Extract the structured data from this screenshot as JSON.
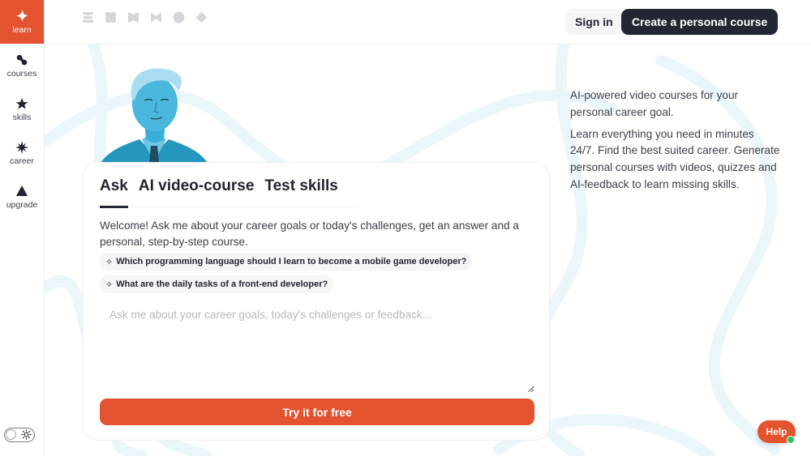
{
  "sidebar": {
    "items": [
      {
        "label": "learn",
        "icon": "sparkle-icon",
        "active": true
      },
      {
        "label": "courses",
        "icon": "link-icon"
      },
      {
        "label": "skills",
        "icon": "star-icon"
      },
      {
        "label": "career",
        "icon": "burst-icon"
      },
      {
        "label": "upgrade",
        "icon": "triangle-up-icon"
      }
    ],
    "theme_toggle": {
      "icon": "sun-icon",
      "state": "light"
    }
  },
  "header": {
    "partner_logos": [
      "stack-logo",
      "squircle-logo",
      "bowtie-logo-1",
      "bowtie-logo-2",
      "circle-logo",
      "gear-logo"
    ],
    "signin_label": "Sign in",
    "create_label": "Create a personal course"
  },
  "card": {
    "tabs": [
      {
        "label": "Ask",
        "active": true
      },
      {
        "label": "AI video-course"
      },
      {
        "label": "Test skills"
      }
    ],
    "welcome": "Welcome! Ask me about your career goals or today's challenges, get an answer and a personal, step-by-step course.",
    "suggestions": [
      {
        "icon": "✧",
        "text": "Which programming language should I learn to become a mobile game developer?"
      },
      {
        "icon": "✧",
        "text": "What are the daily tasks of a front-end developer?"
      }
    ],
    "input": {
      "value": "",
      "placeholder": "Ask me about your career goals, today's challenges or feedback..."
    },
    "cta_label": "Try it for free"
  },
  "side_copy": {
    "p1": "AI-powered video courses for your personal career goal.",
    "p2": "Learn everything you need in minutes 24/7. Find the best suited career. Generate personal courses with videos, quizzes and AI-feedback to learn missing skills."
  },
  "help": {
    "label": "Help",
    "status": "online"
  },
  "colors": {
    "accent": "#e4532f",
    "dark": "#232733",
    "portrait": "#2ea3c9",
    "online": "#22c55e"
  }
}
